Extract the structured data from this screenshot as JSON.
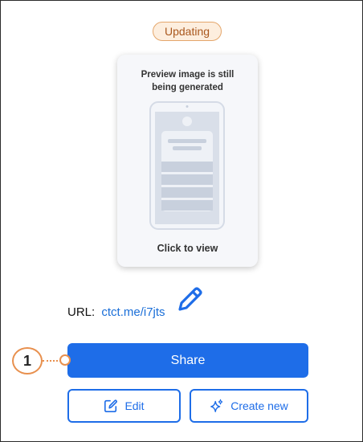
{
  "status": {
    "badge": "Updating"
  },
  "preview": {
    "message_line1": "Preview image is still",
    "message_line2": "being generated",
    "click_label": "Click to view"
  },
  "url": {
    "label": "URL:",
    "link_text": "ctct.me/i7jts"
  },
  "actions": {
    "share_label": "Share",
    "edit_label": "Edit",
    "create_new_label": "Create new"
  },
  "annotation": {
    "number": "1"
  },
  "colors": {
    "primary": "#1e6de8",
    "badge_bg": "#fdeede",
    "badge_border": "#e4a66b",
    "callout": "#e8904e"
  },
  "icons": {
    "edit_link": "pencil-icon",
    "edit_button": "edit-square-icon",
    "create_new": "sparkle-icon"
  }
}
